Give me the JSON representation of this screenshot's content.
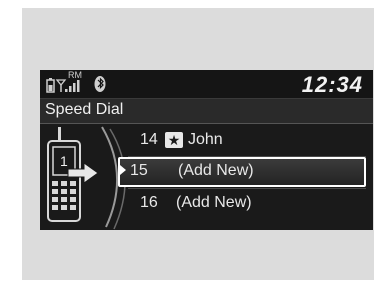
{
  "status": {
    "clock": "12:34",
    "roaming_label": "RM",
    "icons": [
      "battery-icon",
      "signal-icon",
      "bluetooth-icon"
    ]
  },
  "header": {
    "title": "Speed Dial"
  },
  "speed_dial": {
    "items": [
      {
        "number": "14",
        "name": "John",
        "has_voice_tag": true,
        "selected": false
      },
      {
        "number": "15",
        "name": "(Add New)",
        "has_voice_tag": false,
        "selected": true
      },
      {
        "number": "16",
        "name": "(Add New)",
        "has_voice_tag": false,
        "selected": false
      }
    ],
    "phone_badge": "1"
  },
  "colors": {
    "screen_bg": "#1a1a1a",
    "text": "#e8e8e8",
    "selection_border": "#ffffff"
  }
}
